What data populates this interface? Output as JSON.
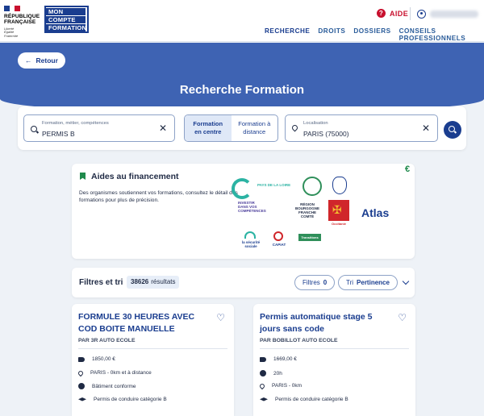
{
  "header": {
    "republic": [
      "RÉPUBLIQUE",
      "FRANÇAISE"
    ],
    "motto": [
      "Liberté",
      "Égalité",
      "Fraternité"
    ],
    "brand": [
      "MON",
      "COMPTE",
      "FORMATION"
    ],
    "help_label": "AIDE",
    "nav": [
      {
        "label": "RECHERCHE",
        "active": true
      },
      {
        "label": "DROITS",
        "active": false
      },
      {
        "label": "DOSSIERS",
        "active": false
      },
      {
        "label": "CONSEILS PROFESSIONNELS",
        "active": false
      }
    ],
    "colors": {
      "brand_blue": "#1a3d8f",
      "alert_red": "#c8102e"
    }
  },
  "hero": {
    "back_label": "Retour",
    "title": "Recherche Formation"
  },
  "search": {
    "what_label": "Formation, métier, compétences",
    "what_value": "PERMIS B",
    "mode_onsite": [
      "Formation",
      "en centre"
    ],
    "mode_remote": [
      "Formation à",
      "distance"
    ],
    "where_label": "Localisation",
    "where_value": "PARIS (75000)"
  },
  "financing": {
    "title": "Aides au financement",
    "text": "Des organismes soutiennent vos formations, consultez le détail des formations pour plus de précision.",
    "euro": "€",
    "logos": {
      "pays_loire": "PAYS DE LA LOIRE",
      "bfc": [
        "RÉGION",
        "BOURGOGNE",
        "FRANCHE",
        "COMTÉ"
      ],
      "investir": [
        "INVESTIR",
        "DANS VOS",
        "COMPÉTENCES"
      ],
      "occitanie": "Occitanie",
      "atlas": "Atlas",
      "securite": [
        "la sécurité",
        "sociale"
      ],
      "capiat": "CAPIAT",
      "transitions": "Transitions Pro"
    }
  },
  "filters": {
    "title": "Filtres et tri",
    "count": "38626",
    "count_suffix": "résultats",
    "filter_label": "Filtres",
    "filter_count": "0",
    "sort_label": "Tri",
    "sort_value": "Pertinence"
  },
  "results": [
    {
      "title": "FORMULE 30 HEURES AVEC COD BOITE MANUELLE",
      "provider": "PAR 3R AUTO ECOLE",
      "price": "1850,00 €",
      "location": "PARIS - 0km et à distance",
      "accessibility": "Bâtiment conforme",
      "certification": "Permis de conduire catégorie B"
    },
    {
      "title": "Permis automatique stage 5 jours sans code",
      "provider": "PAR BOBILLOT AUTO ECOLE",
      "price": "1669,00 €",
      "duration": "20h",
      "location": "PARIS - 0km",
      "certification": "Permis de conduire catégorie B"
    }
  ]
}
